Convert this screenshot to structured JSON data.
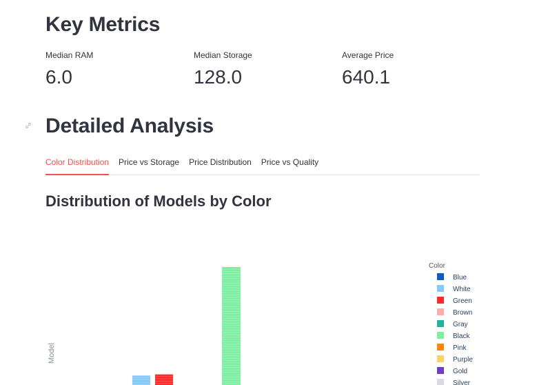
{
  "key_metrics": {
    "title": "Key Metrics",
    "items": [
      {
        "label": "Median RAM",
        "value": "6.0"
      },
      {
        "label": "Median Storage",
        "value": "128.0"
      },
      {
        "label": "Average Price",
        "value": "640.1"
      }
    ]
  },
  "analysis": {
    "title": "Detailed Analysis",
    "tabs": [
      {
        "label": "Color Distribution",
        "active": true
      },
      {
        "label": "Price vs Storage",
        "active": false
      },
      {
        "label": "Price Distribution",
        "active": false
      },
      {
        "label": "Price vs Quality",
        "active": false
      }
    ],
    "chart_heading": "Distribution of Models by Color",
    "accent_color": "#ff4b4b"
  },
  "chart_data": {
    "type": "bar",
    "ylabel": "Model",
    "legend_title": "Color",
    "legend_position": "right",
    "series": [
      {
        "name": "Blue",
        "color": "#0d5dbf"
      },
      {
        "name": "White",
        "color": "#83c9ff"
      },
      {
        "name": "Green",
        "color": "#ff2b2b"
      },
      {
        "name": "Brown",
        "color": "#ffabab"
      },
      {
        "name": "Gray",
        "color": "#29b09d"
      },
      {
        "name": "Black",
        "color": "#7defa1"
      },
      {
        "name": "Pink",
        "color": "#ff8700"
      },
      {
        "name": "Purple",
        "color": "#ffd16a"
      },
      {
        "name": "Gold",
        "color": "#6d3fc0"
      },
      {
        "name": "Silver",
        "color": "#d5dae5"
      }
    ],
    "visible_bars": [
      {
        "series": "White",
        "relative_height": 0.08
      },
      {
        "series": "Green",
        "relative_height": 0.09
      },
      {
        "series": "Black",
        "relative_height": 1.0
      }
    ]
  }
}
